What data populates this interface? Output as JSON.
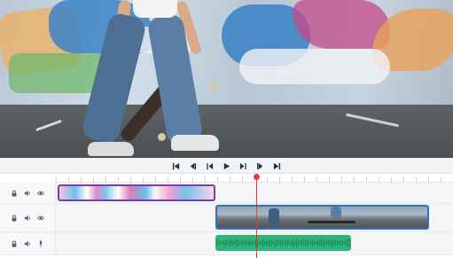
{
  "preview": {
    "description_icon": "video-frame"
  },
  "transport": {
    "buttons": [
      {
        "name": "skip-to-start-button",
        "icon": "skip-to-start-icon"
      },
      {
        "name": "previous-frame-button",
        "icon": "previous-frame-icon"
      },
      {
        "name": "rewind-button",
        "icon": "rewind-icon"
      },
      {
        "name": "play-button",
        "icon": "play-icon"
      },
      {
        "name": "fast-forward-button",
        "icon": "fast-forward-icon"
      },
      {
        "name": "next-frame-button",
        "icon": "next-frame-icon"
      },
      {
        "name": "skip-to-end-button",
        "icon": "skip-to-end-icon"
      }
    ]
  },
  "tracks": [
    {
      "type": "overlay",
      "icons": [
        "lock-icon",
        "volume-icon",
        "visibility-icon"
      ],
      "clip_color": "#7b3fa3"
    },
    {
      "type": "video",
      "icons": [
        "lock-icon",
        "volume-icon",
        "visibility-icon"
      ],
      "clip_color": "#2f6fd1"
    },
    {
      "type": "audio",
      "icons": [
        "lock-icon",
        "volume-icon",
        "microphone-icon"
      ],
      "clip_color": "#2fb57c"
    }
  ],
  "colors": {
    "playhead": "#e53935",
    "audio_clip": "#2fb57c",
    "video_clip_border": "#2f6fd1",
    "overlay_clip_border": "#7b3fa3"
  }
}
